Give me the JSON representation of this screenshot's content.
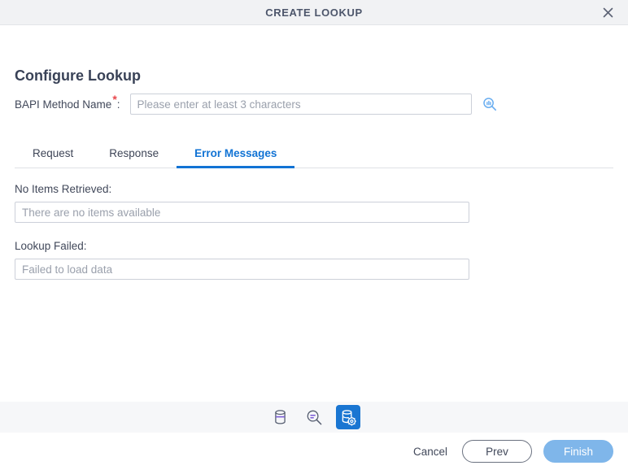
{
  "titlebar": {
    "title": "CREATE LOOKUP",
    "close_icon": "close-icon"
  },
  "section": {
    "heading": "Configure Lookup"
  },
  "bapi_field": {
    "label": "BAPI Method Name",
    "required_marker": "*",
    "colon": ":",
    "value": "",
    "placeholder": "Please enter at least 3 characters",
    "lookup_icon": "search-chart-icon"
  },
  "tabs": [
    {
      "label": "Request",
      "active": false
    },
    {
      "label": "Response",
      "active": false
    },
    {
      "label": "Error Messages",
      "active": true
    }
  ],
  "error_messages": {
    "no_items": {
      "label": "No Items Retrieved:",
      "value": "",
      "placeholder": "There are no items available"
    },
    "lookup_failed": {
      "label": "Lookup Failed:",
      "value": "",
      "placeholder": "Failed to load data"
    }
  },
  "icon_toolbar": [
    {
      "name": "database-icon",
      "active": false
    },
    {
      "name": "search-list-icon",
      "active": false
    },
    {
      "name": "database-settings-icon",
      "active": true
    }
  ],
  "footer": {
    "cancel_label": "Cancel",
    "prev_label": "Prev",
    "finish_label": "Finish"
  },
  "colors": {
    "accent_blue": "#1173d4",
    "active_tool_bg": "#1a76d2",
    "required_red": "#e8474c",
    "icon_purple": "#7b5bd6",
    "finish_bg": "#7fb6ea",
    "titlebar_bg": "#f1f2f4",
    "toolbar_bg": "#f6f7f9"
  }
}
